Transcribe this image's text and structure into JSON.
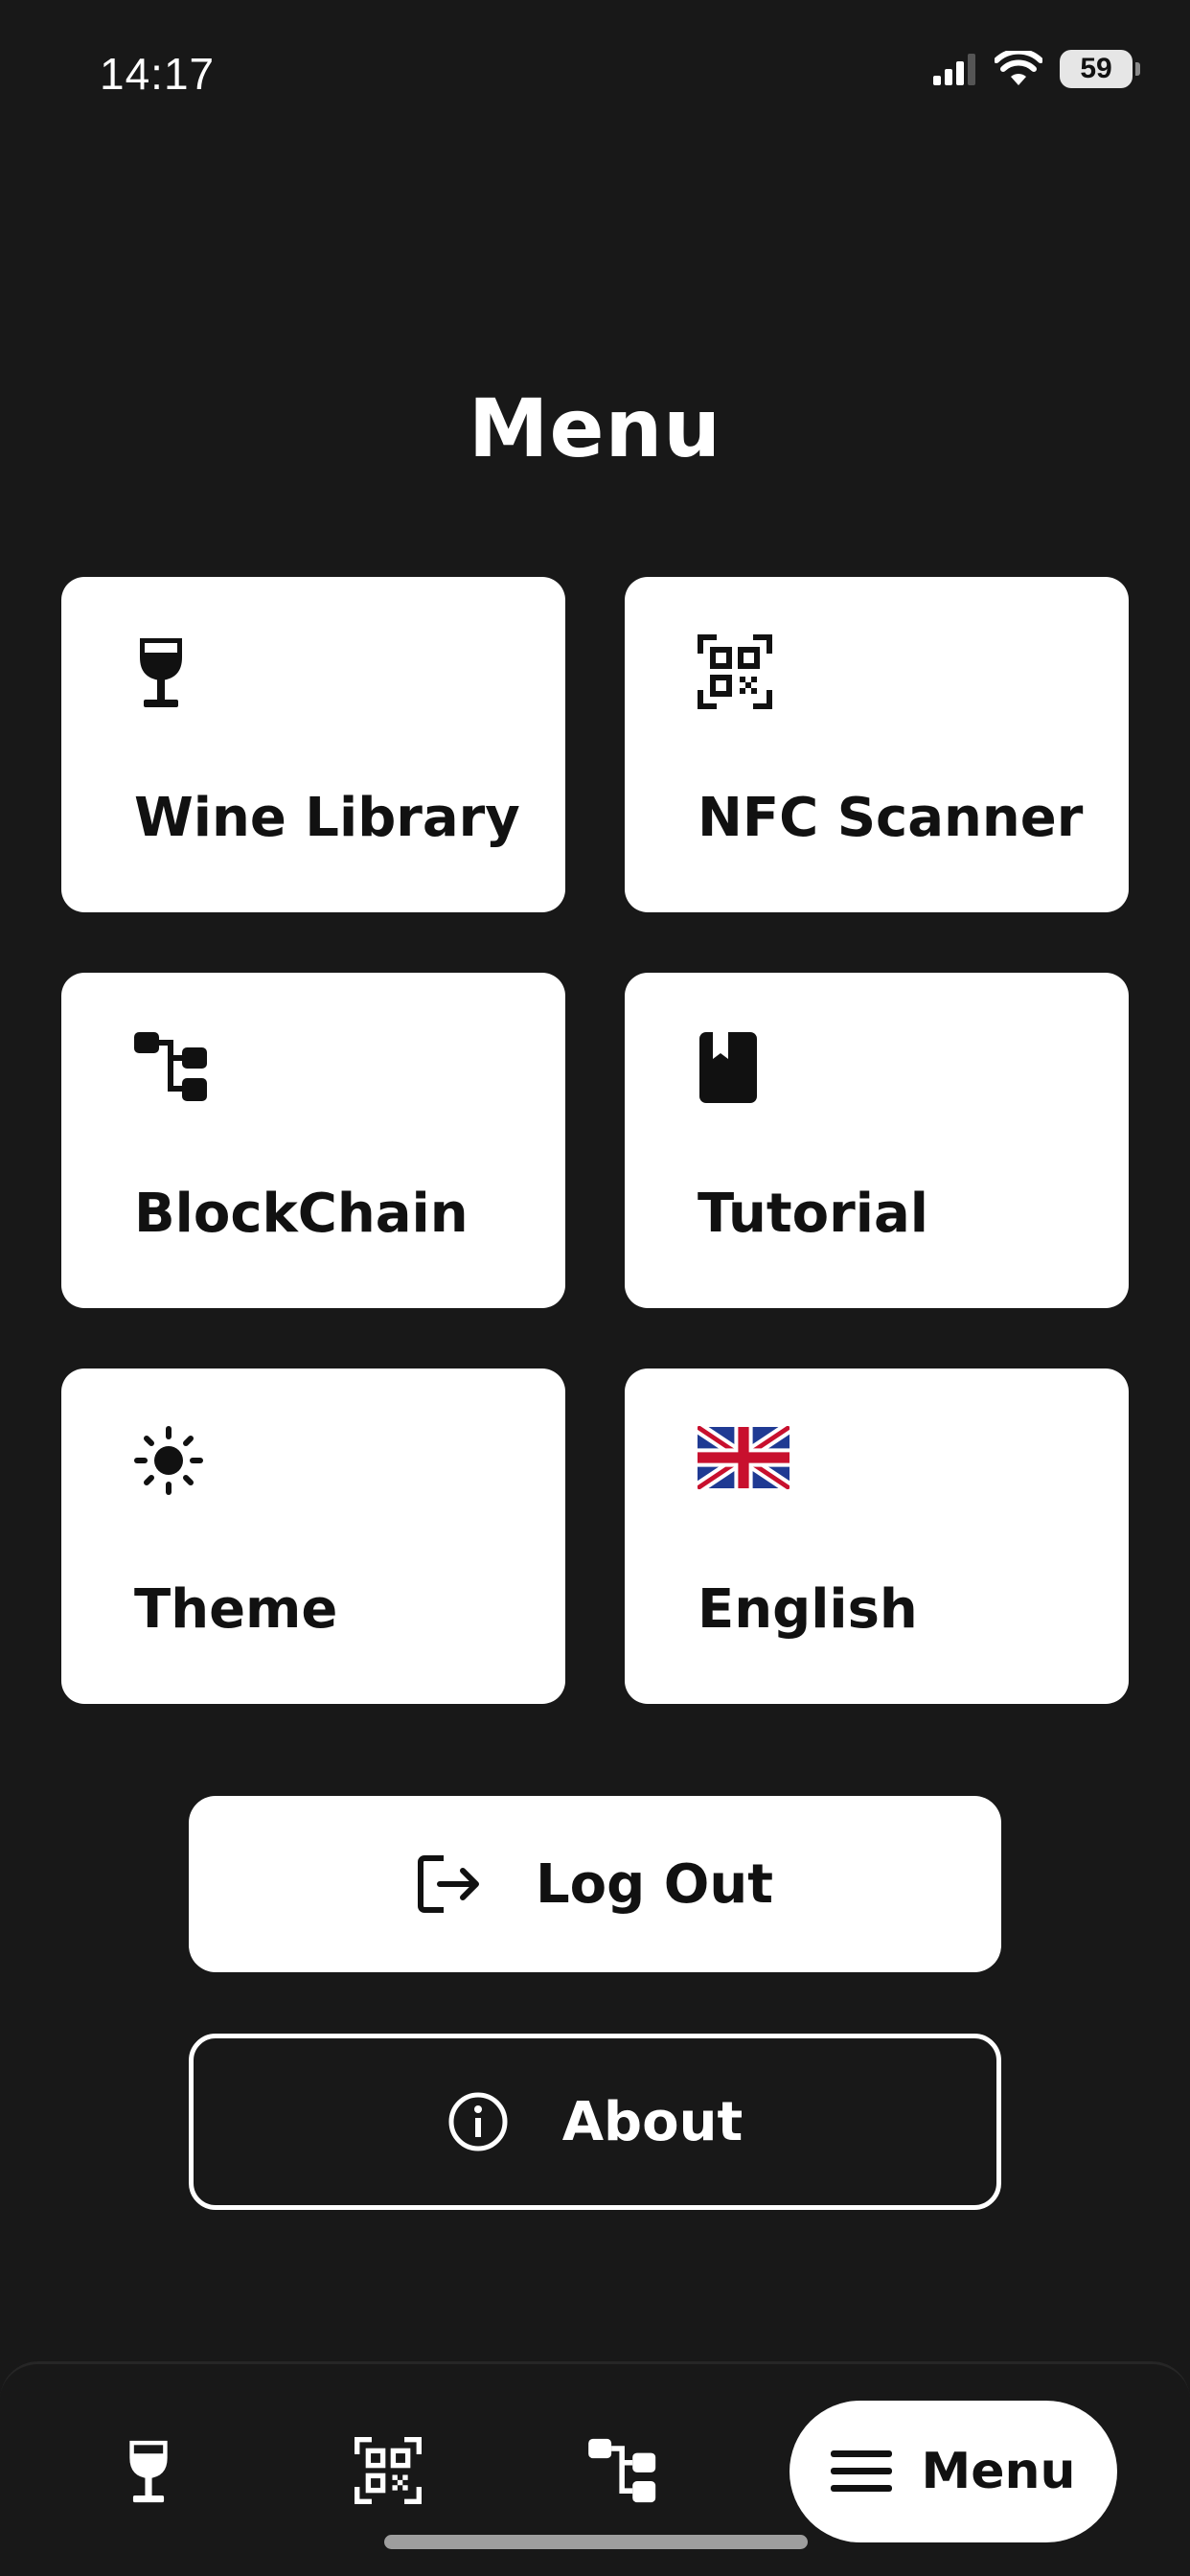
{
  "status_bar": {
    "time": "14:17",
    "battery": "59"
  },
  "page": {
    "title": "Menu"
  },
  "menu_items": [
    {
      "label": "Wine Library",
      "icon": "wine-glass-icon"
    },
    {
      "label": "NFC Scanner",
      "icon": "qr-scan-icon"
    },
    {
      "label": "BlockChain",
      "icon": "blockchain-icon"
    },
    {
      "label": "Tutorial",
      "icon": "bookmark-book-icon"
    },
    {
      "label": "Theme",
      "icon": "sun-icon"
    },
    {
      "label": "English",
      "icon": "uk-flag-icon"
    }
  ],
  "buttons": {
    "logout": {
      "label": "Log Out",
      "icon": "logout-icon"
    },
    "about": {
      "label": "About",
      "icon": "info-icon"
    }
  },
  "bottom_nav": {
    "items": [
      {
        "icon": "wine-glass-icon"
      },
      {
        "icon": "qr-scan-icon"
      },
      {
        "icon": "blockchain-icon"
      }
    ],
    "active": {
      "label": "Menu",
      "icon": "hamburger-icon"
    }
  },
  "colors": {
    "background": "#181818",
    "card": "#ffffff",
    "text_dark": "#111111"
  }
}
